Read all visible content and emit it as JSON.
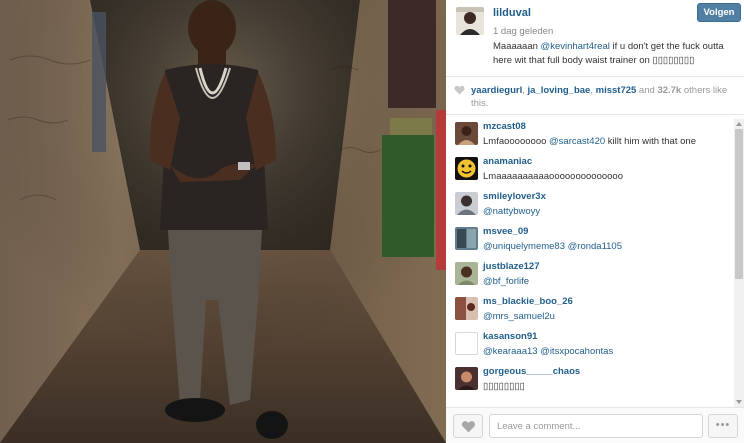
{
  "post": {
    "owner_username": "lilduval",
    "time_ago": "1 dag geleden",
    "follow_label": "Volgen",
    "caption": {
      "prefix": "Maaaaaan ",
      "mention": "@kevinhart4real",
      "suffix": " if u don't get the fuck outta here wit that full body waist trainer on ",
      "emoji": "▯▯▯▯▯▯▯▯"
    }
  },
  "likes": {
    "users": [
      "yaardiegurl",
      "ja_loving_bae",
      "misst725"
    ],
    "separator": ", ",
    "and_word": " and ",
    "count": "32.7k",
    "suffix": " others like this."
  },
  "comments": [
    {
      "user": "mzcast08",
      "pre": "Lmfaoooooooo ",
      "mention": "@sarcast420",
      "post": " killt him with that one",
      "avatar_color": "#6b4a3a"
    },
    {
      "user": "anamaniac",
      "pre": "Lmaaaaaaaaaaoooooooooooooo",
      "mention": "",
      "post": "",
      "avatar_color": "#f2c230"
    },
    {
      "user": "smileylover3x",
      "pre": "",
      "mention": "@nattybwoyy",
      "post": "",
      "avatar_color": "#8a8f99"
    },
    {
      "user": "msvee_09",
      "pre": "",
      "mention": "@uniquelymeme83 @ronda1105",
      "post": "",
      "avatar_color": "#5f7f8f"
    },
    {
      "user": "justblaze127",
      "pre": "",
      "mention": "@bf_forlife",
      "post": "",
      "avatar_color": "#7d8a6a"
    },
    {
      "user": "ms_blackie_boo_26",
      "pre": "",
      "mention": "@mrs_samuel2u",
      "post": "",
      "avatar_color": "#8b5040"
    },
    {
      "user": "kasanson91",
      "pre": "",
      "mention": "@kearaaa13 @itsxpocahontas",
      "post": "",
      "avatar_color": "#ffffff"
    },
    {
      "user": "gorgeous_____chaos",
      "pre": "▯▯▯▯▯▯▯▯",
      "mention": "",
      "post": "",
      "avatar_color": "#4a3030"
    }
  ],
  "footer": {
    "comment_placeholder": "Leave a comment...",
    "more_label": "•••"
  },
  "icons": {
    "like": "heart-icon",
    "more": "ellipsis-icon"
  },
  "colors": {
    "link": "#1f5e8c",
    "follow_button": "#517fa4",
    "muted_text": "#999999"
  }
}
